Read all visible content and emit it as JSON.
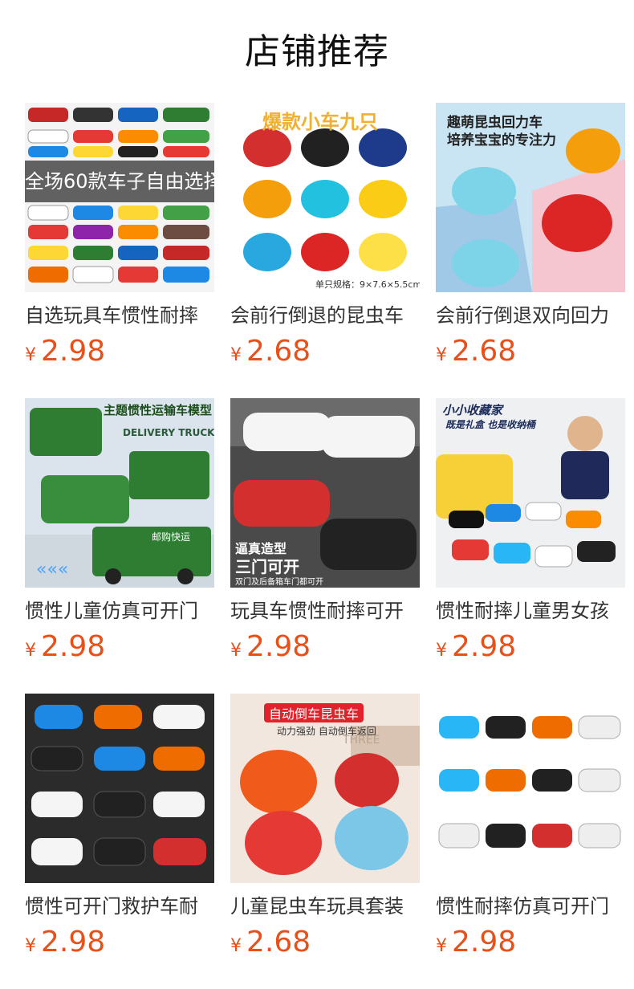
{
  "page": {
    "title": "店铺推荐"
  },
  "currency_symbol": "¥",
  "colors": {
    "price": "#e8501a",
    "background": "#ffffff"
  },
  "products": [
    {
      "name": "自选玩具车惯性耐摔",
      "price": "2.98",
      "image_overlay": "全场60款车子自由选择"
    },
    {
      "name": "会前行倒退的昆虫车",
      "price": "2.68",
      "image_heading": "爆款小车九只",
      "image_caption": "单只规格：9×7.6×5.5cm"
    },
    {
      "name": "会前行倒退双向回力",
      "price": "2.68",
      "image_heading": "趣萌昆虫回力车",
      "image_subheading": "培养宝宝的专注力"
    },
    {
      "name": "惯性儿童仿真可开门",
      "price": "2.98",
      "image_heading": "主题惯性运输车模型",
      "image_subheading": "DELIVERY TRUCK",
      "image_tag": "邮购快运"
    },
    {
      "name": "玩具车惯性耐摔可开",
      "price": "2.98",
      "image_heading": "逼真造型",
      "image_subheading": "三门可开",
      "image_caption": "双门及后备箱车门都可开"
    },
    {
      "name": "惯性耐摔儿童男女孩",
      "price": "2.98",
      "image_heading": "小小收藏家",
      "image_subheading": "既是礼盒 也是收纳桶"
    },
    {
      "name": "惯性可开门救护车耐",
      "price": "2.98"
    },
    {
      "name": "儿童昆虫车玩具套装",
      "price": "2.68",
      "image_heading": "自动倒车昆虫车",
      "image_subheading": "动力强劲 自动倒车返回",
      "image_tag": "THREE"
    },
    {
      "name": "惯性耐摔仿真可开门",
      "price": "2.98"
    }
  ]
}
